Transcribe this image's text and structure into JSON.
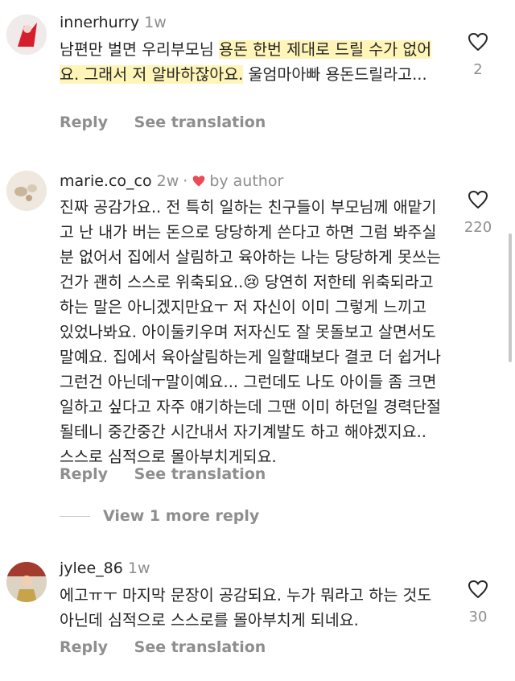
{
  "comments": [
    {
      "username": "innerhurry",
      "time": "1w",
      "text_before": "남편만 벌면 우리부모님 ",
      "text_highlight_1": "용돈 한번 제대로 드릴 수가 없어요. 그래서 저 알바하잖아요.",
      "text_after": " 울엄마아빠 용돈드릴라고...",
      "likes": "2",
      "reply": "Reply",
      "see_translation": "See translation"
    },
    {
      "username": "marie.co_co",
      "time": "2w",
      "by_author": "by author",
      "text": "진짜 공감가요.. 전 특히 일하는 친구들이 부모님께 애맡기고 난 내가 버는 돈으로 당당하게 쓴다고 하면 그럼 봐주실분 없어서 집에서 살림하고 육아하는 나는 당당하게 못쓰는건가 괜히 스스로 위축되요..😢 당연히 저한테 위축되라고 하는 말은 아니겠지만요ㅜ 저 자신이 이미 그렇게 느끼고 있었나봐요. 아이둘키우며 저자신도 잘 못돌보고 살면서도 말예요. 집에서 육아살림하는게 일할때보다 결코 더 쉽거나 그런건 아닌데ㅜ말이예요... 그런데도 나도 아이들 좀 크면 일하고 싶다고 자주 얘기하는데 그땐 이미 하던일 경력단절될테니 중간중간 시간내서 자기계발도 하고 해야겠지요.. 스스로 심적으로 몰아부치게되요.",
      "likes": "220",
      "reply": "Reply",
      "see_translation": "See translation",
      "view_more": "View 1 more reply"
    },
    {
      "username": "jylee_86",
      "time": "1w",
      "text": "에고ㅠㅜ 마지막 문장이 공감되요. 누가 뭐라고 하는 것도 아닌데 심적으로 스스로를 몰아부치게 되네요.",
      "likes": "30",
      "reply": "Reply",
      "see_translation": "See translation"
    }
  ],
  "colors": {
    "text": "#262626",
    "muted": "#8e8e8e",
    "author_heart": "#ed4956",
    "highlight": "#fff2a0"
  }
}
